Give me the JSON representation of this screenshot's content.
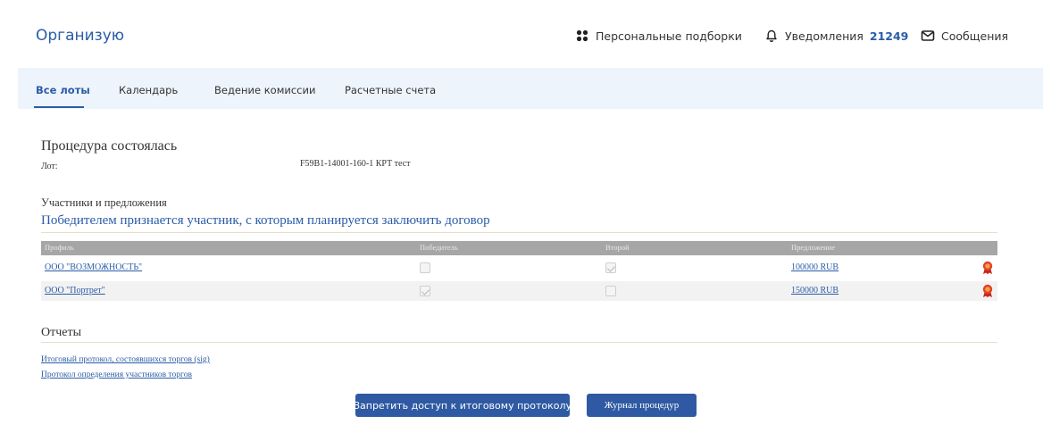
{
  "header": {
    "brand": "Организую",
    "personal": "Персональные подборки",
    "notifications_label": "Уведомления",
    "notifications_count": "21249",
    "messages": "Сообщения"
  },
  "tabs": [
    {
      "label": "Все лоты",
      "active": true
    },
    {
      "label": "Календарь",
      "active": false
    },
    {
      "label": "Ведение комиссии",
      "active": false
    },
    {
      "label": "Расчетные счета",
      "active": false
    }
  ],
  "procedure": {
    "status": "Процедура состоялась",
    "lot_label": "Лот:",
    "lot_value": "F59B1-14001-160-1 КРТ тест"
  },
  "participants": {
    "title": "Участники и предложения",
    "winner_rule": "Победителем признается участник, с которым планируется заключить договор",
    "columns": [
      "Профиль",
      "Победитель",
      "Второй",
      "Предложение"
    ],
    "rows": [
      {
        "profile": "ООО \"ВОЗМОЖНОСТЬ\"",
        "winner": false,
        "second": true,
        "offer": "100000 RUB"
      },
      {
        "profile": "ООО \"Портрет\"",
        "winner": true,
        "second": false,
        "offer": "150000 RUB"
      }
    ]
  },
  "reports": {
    "title": "Отчеты",
    "final_protocol": "Итоговый протокол, состоявшихся торгов",
    "final_protocol_sig": "(sig)",
    "participants_protocol": "Протокол определения участников торгов"
  },
  "buttons": {
    "deny_access": "Запретить доступ к итоговому протоколу",
    "journal": "Журнал процедур"
  },
  "colors": {
    "accent": "#2a5ca8",
    "nav_bg": "#eef4fb",
    "table_header": "#a6a6a6",
    "button": "#2f5aa3",
    "award": "#d9382b"
  }
}
